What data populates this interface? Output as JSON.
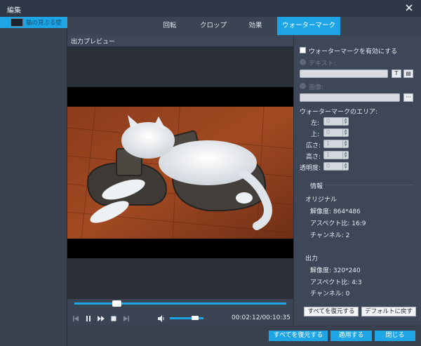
{
  "window": {
    "title": "編集"
  },
  "left": {
    "file_name": "猫の見ぶる壁"
  },
  "tabs": [
    {
      "label": "回転"
    },
    {
      "label": "クロップ"
    },
    {
      "label": "効果"
    },
    {
      "label": "ウォーターマーク"
    }
  ],
  "preview": {
    "header": "出力プレビュー"
  },
  "player": {
    "time": "00:02:12/00:10:35",
    "seek_fraction": 0.2,
    "volume_fraction": 0.75
  },
  "watermark": {
    "enable_label": "ウォーターマークを有効にする",
    "text_label": "テキスト:",
    "image_label": "画像:",
    "image_browse": "···",
    "text_btn": "T",
    "text_btn2": "▤",
    "area_label": "ウォーターマークのエリア:",
    "fields": [
      {
        "label": "左:",
        "value": "0"
      },
      {
        "label": "上:",
        "value": "0"
      },
      {
        "label": "広さ:",
        "value": "1"
      },
      {
        "label": "高さ:",
        "value": "1"
      },
      {
        "label": "透明度:",
        "value": "0"
      }
    ]
  },
  "info": {
    "title": "情報",
    "original": {
      "heading": "オリジナル",
      "resolution": "解像度: 864*486",
      "aspect": "アスペクト比: 16:9",
      "channels": "チャンネル: 2"
    },
    "output": {
      "heading": "出力",
      "resolution": "解像度: 320*240",
      "aspect": "アスペクト比: 4:3",
      "channels": "チャンネル: 0"
    }
  },
  "buttons": {
    "restore_all_small": "すべてを復元する",
    "default": "デフォルトに戻す",
    "restore_all": "すべてを復元する",
    "apply": "適用する",
    "close": "閉じる"
  },
  "colors": {
    "accent": "#1ea5e6",
    "panel": "#3d4758",
    "window": "#2f3846"
  }
}
